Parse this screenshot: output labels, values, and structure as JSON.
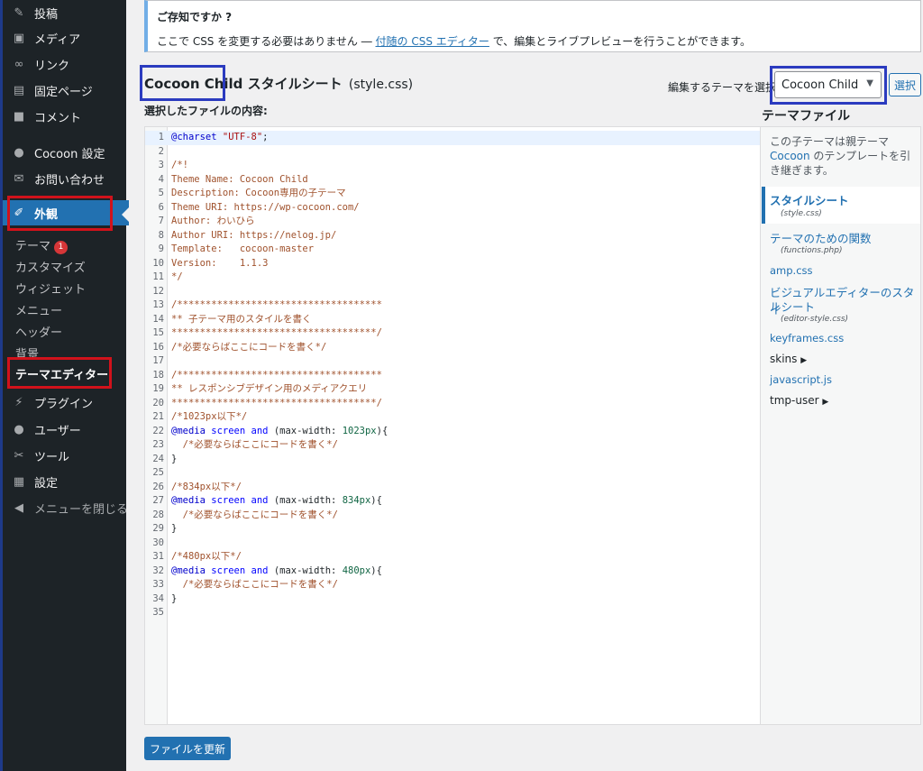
{
  "sidebar": {
    "items": [
      {
        "icon": "pushpin-icon",
        "glyph": "✎",
        "label": "投稿"
      },
      {
        "icon": "media-icon",
        "glyph": "▣",
        "label": "メディア"
      },
      {
        "icon": "link-icon",
        "glyph": "∞",
        "label": "リンク"
      },
      {
        "icon": "page-icon",
        "glyph": "▤",
        "label": "固定ページ"
      },
      {
        "icon": "comment-icon",
        "glyph": "■",
        "label": "コメント"
      },
      {
        "icon": "cocoon-icon",
        "glyph": "●",
        "label": "Cocoon 設定"
      },
      {
        "icon": "mail-icon",
        "glyph": "✉",
        "label": "お問い合わせ"
      },
      {
        "icon": "brush-icon",
        "glyph": "✐",
        "label": "外観"
      },
      {
        "icon": "plugin-icon",
        "glyph": "⚡",
        "label": "プラグイン"
      },
      {
        "icon": "user-icon",
        "glyph": "●",
        "label": "ユーザー"
      },
      {
        "icon": "wrench-icon",
        "glyph": "✂",
        "label": "ツール"
      },
      {
        "icon": "settings-icon",
        "glyph": "▦",
        "label": "設定"
      },
      {
        "icon": "collapse-icon",
        "glyph": "◀",
        "label": "メニューを閉じる"
      }
    ],
    "submenu": [
      {
        "label": "テーマ",
        "badge": "1"
      },
      {
        "label": "カスタマイズ"
      },
      {
        "label": "ウィジェット"
      },
      {
        "label": "メニュー"
      },
      {
        "label": "ヘッダー"
      },
      {
        "label": "背景"
      },
      {
        "label": "テーマエディター"
      }
    ]
  },
  "notice": {
    "title": "ご存知ですか ?",
    "text_before": "ここで CSS を変更する必要はありません ― ",
    "link": "付随の CSS エディター",
    "text_after": " で、編集とライブプレビューを行うことができます。"
  },
  "header": {
    "theme_name": "Cocoon Child",
    "heading_suffix": " スタイルシート",
    "filename": "(style.css)",
    "content_label": "選択したファイルの内容:",
    "select_label": "編集するテーマを選択:",
    "selected_theme": "Cocoon Child",
    "select_button": "選択"
  },
  "editor": {
    "lines": [
      [
        [
          "def",
          "@charset"
        ],
        [
          "plain",
          " "
        ],
        [
          "str",
          "\"UTF-8\""
        ],
        [
          "plain",
          ";"
        ]
      ],
      [],
      [
        [
          "comment",
          "/*!"
        ]
      ],
      [
        [
          "comment",
          "Theme Name: Cocoon Child"
        ]
      ],
      [
        [
          "comment",
          "Description: Cocoon専用の子テーマ"
        ]
      ],
      [
        [
          "comment",
          "Theme URI: https://wp-cocoon.com/"
        ]
      ],
      [
        [
          "comment",
          "Author: わいひら"
        ]
      ],
      [
        [
          "comment",
          "Author URI: https://nelog.jp/"
        ]
      ],
      [
        [
          "comment",
          "Template:   cocoon-master"
        ]
      ],
      [
        [
          "comment",
          "Version:    1.1.3"
        ]
      ],
      [
        [
          "comment",
          "*/"
        ]
      ],
      [],
      [
        [
          "comment",
          "/************************************"
        ]
      ],
      [
        [
          "comment",
          "** 子テーマ用のスタイルを書く"
        ]
      ],
      [
        [
          "comment",
          "************************************/"
        ]
      ],
      [
        [
          "comment",
          "/*必要ならばここにコードを書く*/"
        ]
      ],
      [],
      [
        [
          "comment",
          "/************************************"
        ]
      ],
      [
        [
          "comment",
          "** レスポンシブデザイン用のメディアクエリ"
        ]
      ],
      [
        [
          "comment",
          "************************************/"
        ]
      ],
      [
        [
          "comment",
          "/*1023px以下*/"
        ]
      ],
      [
        [
          "def",
          "@media"
        ],
        [
          "plain",
          " "
        ],
        [
          "kw",
          "screen"
        ],
        [
          "plain",
          " "
        ],
        [
          "kw",
          "and"
        ],
        [
          "plain",
          " (max-width: "
        ],
        [
          "num",
          "1023px"
        ],
        [
          "plain",
          "){"
        ]
      ],
      [
        [
          "plain",
          "  "
        ],
        [
          "comment",
          "/*必要ならばここにコードを書く*/"
        ]
      ],
      [
        [
          "plain",
          "}"
        ]
      ],
      [],
      [
        [
          "comment",
          "/*834px以下*/"
        ]
      ],
      [
        [
          "def",
          "@media"
        ],
        [
          "plain",
          " "
        ],
        [
          "kw",
          "screen"
        ],
        [
          "plain",
          " "
        ],
        [
          "kw",
          "and"
        ],
        [
          "plain",
          " (max-width: "
        ],
        [
          "num",
          "834px"
        ],
        [
          "plain",
          "){"
        ]
      ],
      [
        [
          "plain",
          "  "
        ],
        [
          "comment",
          "/*必要ならばここにコードを書く*/"
        ]
      ],
      [
        [
          "plain",
          "}"
        ]
      ],
      [],
      [
        [
          "comment",
          "/*480px以下*/"
        ]
      ],
      [
        [
          "def",
          "@media"
        ],
        [
          "plain",
          " "
        ],
        [
          "kw",
          "screen"
        ],
        [
          "plain",
          " "
        ],
        [
          "kw",
          "and"
        ],
        [
          "plain",
          " (max-width: "
        ],
        [
          "num",
          "480px"
        ],
        [
          "plain",
          "){"
        ]
      ],
      [
        [
          "plain",
          "  "
        ],
        [
          "comment",
          "/*必要ならばここにコードを書く*/"
        ]
      ],
      [
        [
          "plain",
          "}"
        ]
      ],
      []
    ]
  },
  "theme_files": {
    "title": "テーマファイル",
    "desc_before": "この子テーマは親テーマ ",
    "desc_link": "Cocoon",
    "desc_after": " のテンプレートを引き継ぎます。",
    "stylesheet_label": "スタイルシート",
    "stylesheet_sub": "(style.css)",
    "functions_label": "テーマのための関数",
    "functions_sub": "(functions.php)",
    "amp_label": "amp.css",
    "visual_label_1": "ビジュアルエディターのスタイ",
    "visual_label_2": "ルシート",
    "visual_sub": "(editor-style.css)",
    "keyframes_label": "keyframes.css",
    "skins_label": "skins",
    "javascript_label": "javascript.js",
    "tmpuser_label": "tmp-user"
  },
  "update_button": "ファイルを更新"
}
